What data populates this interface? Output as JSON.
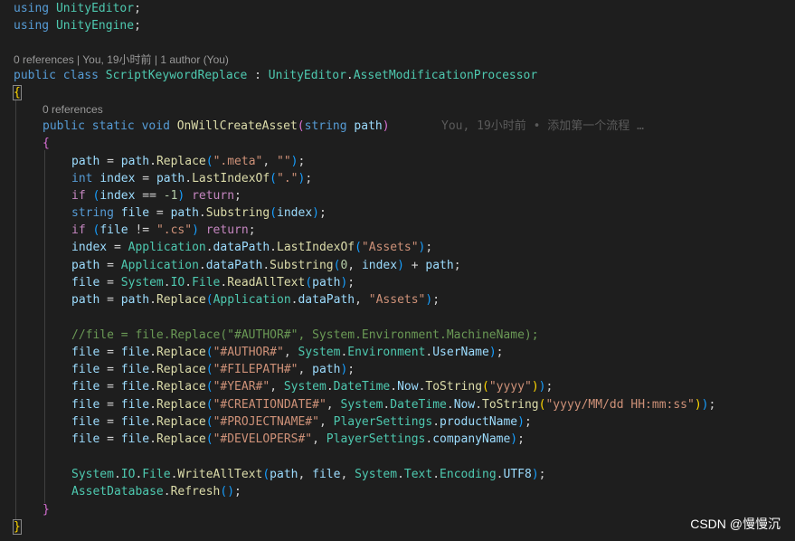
{
  "codelens": {
    "class_lens": "0 references | You, 19小时前 | 1 author (You)",
    "method_lens": "0 references"
  },
  "blame": {
    "text": "You, 19小时前 • 添加第一个流程 …"
  },
  "watermark": {
    "text": "CSDN @慢慢沉"
  },
  "code": {
    "using1": "using UnityEditor;",
    "using2": "using UnityEngine;",
    "class_decl": "public class ScriptKeywordReplace : UnityEditor.AssetModificationProcessor",
    "open_brace": "{",
    "method_decl": "public static void OnWillCreateAsset(string path)",
    "method_open": "{",
    "l1": "path = path.Replace(\".meta\", \"\");",
    "l2": "int index = path.LastIndexOf(\".\");",
    "l3": "if (index == -1) return;",
    "l4": "string file = path.Substring(index);",
    "l5": "if (file != \".cs\") return;",
    "l6": "index = Application.dataPath.LastIndexOf(\"Assets\");",
    "l7": "path = Application.dataPath.Substring(0, index) + path;",
    "l8": "file = System.IO.File.ReadAllText(path);",
    "l9": "path = path.Replace(Application.dataPath, \"Assets\");",
    "comment": "//file = file.Replace(\"#AUTHOR#\", System.Environment.MachineName);",
    "r1": "file = file.Replace(\"#AUTHOR#\", System.Environment.UserName);",
    "r2": "file = file.Replace(\"#FILEPATH#\", path);",
    "r3": "file = file.Replace(\"#YEAR#\", System.DateTime.Now.ToString(\"yyyy\"));",
    "r4": "file = file.Replace(\"#CREATIONDATE#\", System.DateTime.Now.ToString(\"yyyy/MM/dd HH:mm:ss\"));",
    "r5": "file = file.Replace(\"#PROJECTNAME#\", PlayerSettings.productName);",
    "r6": "file = file.Replace(\"#DEVELOPERS#\", PlayerSettings.companyName);",
    "w1": "System.IO.File.WriteAllText(path, file, System.Text.Encoding.UTF8);",
    "w2": "AssetDatabase.Refresh();",
    "method_close": "}",
    "class_close": "}"
  },
  "colors": {
    "background": "#1e1e1e",
    "keyword": "#569cd6",
    "control": "#c586c0",
    "type": "#4ec9b0",
    "function": "#dcdcaa",
    "variable": "#9cdcfe",
    "string": "#ce9178",
    "number": "#b5cea8",
    "comment": "#6a9955"
  }
}
